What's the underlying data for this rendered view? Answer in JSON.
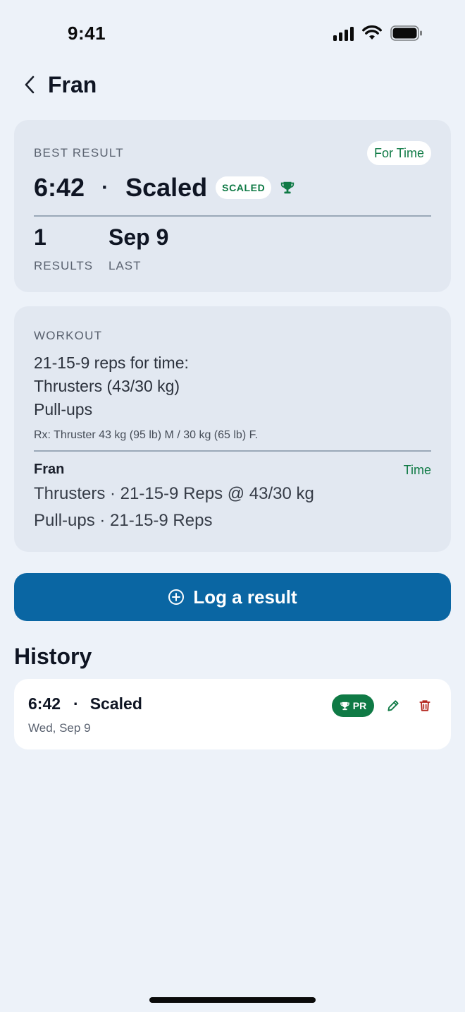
{
  "status_bar": {
    "time": "9:41"
  },
  "header": {
    "title": "Fran"
  },
  "best_result": {
    "label": "BEST RESULT",
    "score_type": "For Time",
    "time": "6:42",
    "separator": "·",
    "scale": "Scaled",
    "scale_chip": "SCALED",
    "results_count": "1",
    "results_label": "RESULTS",
    "last_date": "Sep 9",
    "last_label": "LAST"
  },
  "workout": {
    "label": "WORKOUT",
    "lines": [
      "21-15-9 reps for time:",
      "Thrusters (43/30 kg)",
      "Pull-ups"
    ],
    "rx_note": "Rx: Thruster 43 kg (95 lb) M / 30 kg (65 lb) F.",
    "name": "Fran",
    "type": "Time",
    "movements": [
      "Thrusters · 21-15-9 Reps @ 43/30 kg",
      "Pull-ups · 21-15-9 Reps"
    ]
  },
  "log_button": {
    "label": "Log a result"
  },
  "history": {
    "title": "History",
    "items": [
      {
        "time": "6:42",
        "separator": "·",
        "scale": "Scaled",
        "date": "Wed, Sep 9",
        "badge": "PR"
      }
    ]
  },
  "colors": {
    "accent_green": "#0f7a45",
    "primary_blue": "#0a66a3",
    "danger_red": "#b3261e",
    "background": "#edf2f9",
    "card": "#e2e8f1"
  },
  "icons": [
    "back-chevron-icon",
    "trophy-icon",
    "plus-circle-icon",
    "pencil-icon",
    "trash-icon",
    "cellular-signal-icon",
    "wifi-icon",
    "battery-icon"
  ]
}
